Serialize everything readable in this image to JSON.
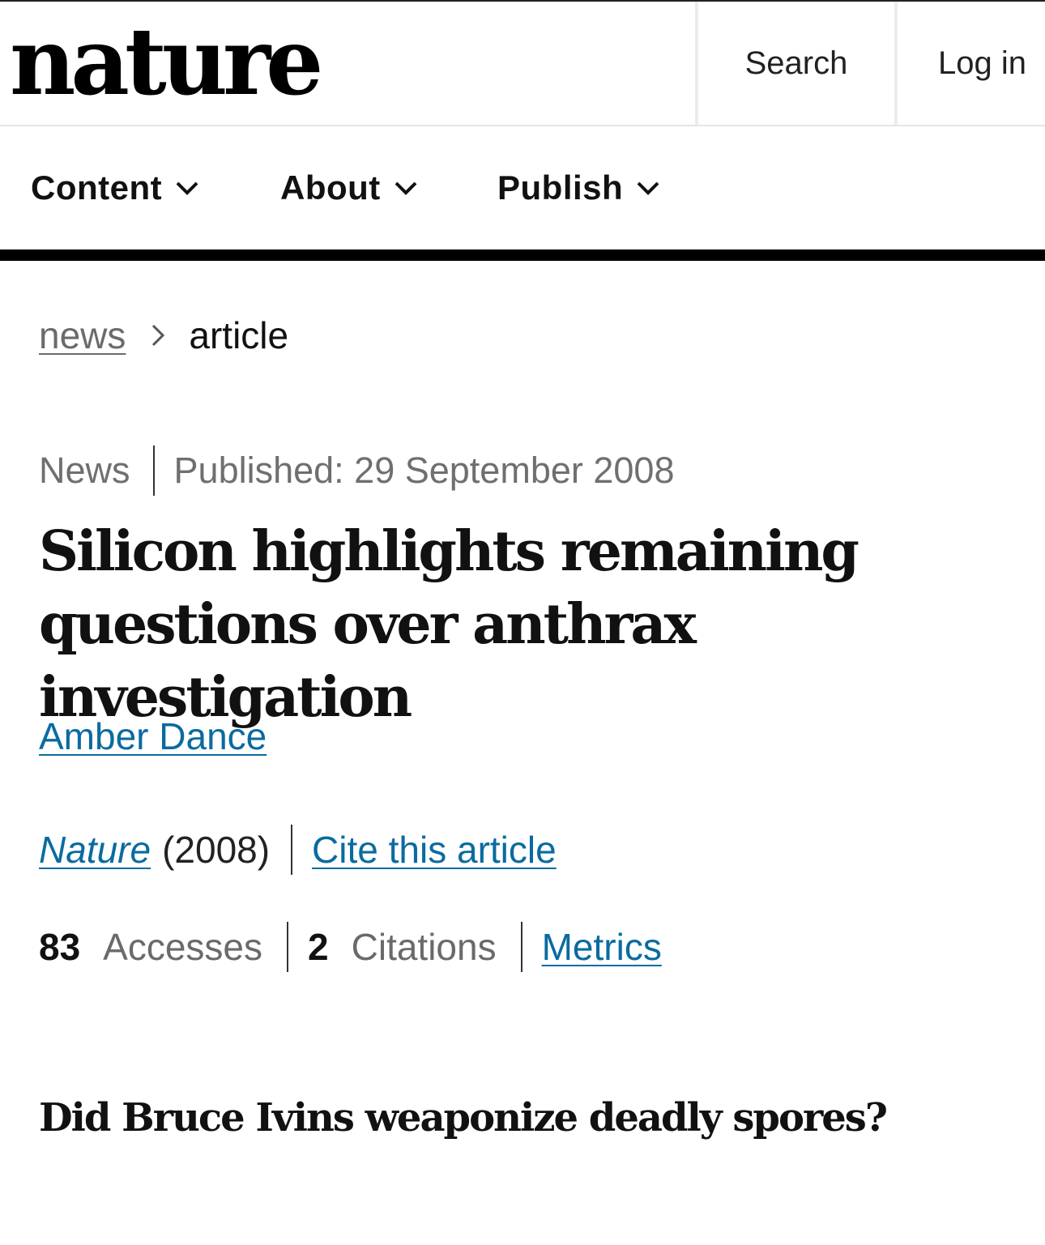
{
  "header": {
    "logo": "nature",
    "search_label": "Search",
    "login_label": "Log in"
  },
  "nav": {
    "items": [
      {
        "label": "Content",
        "icon": "chevron-down-icon"
      },
      {
        "label": "About",
        "icon": "chevron-down-icon"
      },
      {
        "label": "Publish",
        "icon": "chevron-down-icon"
      }
    ]
  },
  "breadcrumb": {
    "link": "news",
    "separator_icon": "chevron-right-icon",
    "current": "article"
  },
  "article": {
    "type": "News",
    "published": "Published: 29 September 2008",
    "title": "Silicon highlights remaining questions over anthrax investigation",
    "author": "Amber Dance",
    "journal": "Nature",
    "year": "(2008)",
    "cite_label": "Cite this article",
    "accesses_count": "83",
    "accesses_label": "Accesses",
    "citations_count": "2",
    "citations_label": "Citations",
    "metrics_label": "Metrics",
    "standfirst": "Did Bruce Ivins weaponize deadly spores?"
  },
  "colors": {
    "link": "#0a6ba0",
    "muted": "#6f6f6f",
    "text": "#111111"
  }
}
